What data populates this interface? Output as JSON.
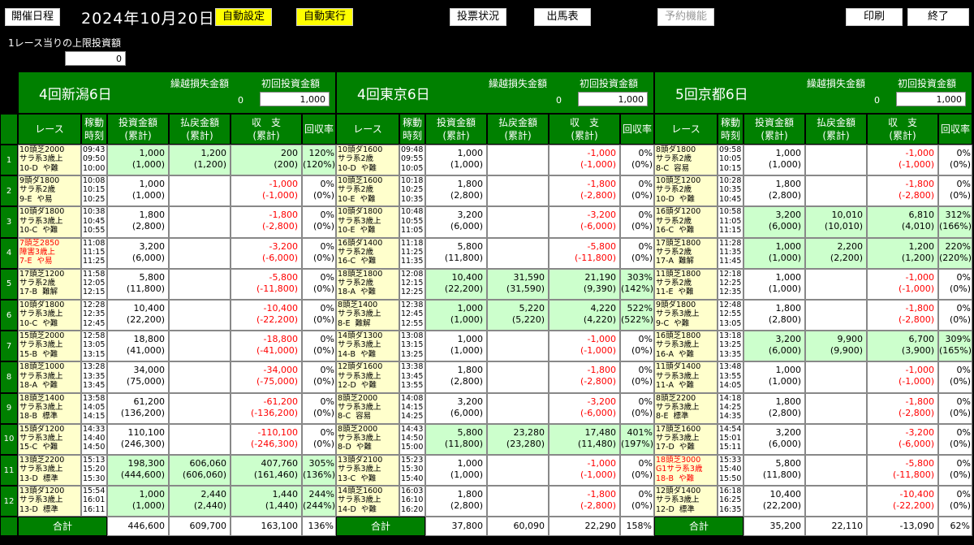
{
  "toolbar": {
    "schedule": "開催日程",
    "date": "2024年10月20日",
    "auto_set": "自動設定",
    "auto_run": "自動実行",
    "vote_status": "投票状況",
    "entries": "出馬表",
    "reserve": "予約機能",
    "print": "印刷",
    "exit": "終了"
  },
  "limit": {
    "label": "1レース当りの上限投資額",
    "value": "0"
  },
  "labels": {
    "carryover": "繰越損失金額",
    "initial": "初回投資金額",
    "race": "レース",
    "op1": "稼動",
    "op2": "時刻",
    "inv1": "投資金額",
    "inv2": "(累計)",
    "pay1": "払戻金額",
    "pay2": "(累計)",
    "bal1": "収　支",
    "bal2": "(累計)",
    "ret": "回収率",
    "total": "合計"
  },
  "venues": [
    {
      "name": "4回新潟6日",
      "carryover": "0",
      "initial": "1,000",
      "total": {
        "invest": "446,600",
        "payout": "609,700",
        "balance": "163,100",
        "rate": "136%"
      },
      "rows": [
        {
          "race": "10頭芝2000\nサラ系3歳上\n10-D  や難",
          "time": "09:43\n09:50\n10:00",
          "inv": "1,000",
          "invc": "(1,000)",
          "pay": "1,200",
          "payc": "(1,200)",
          "bal": "200",
          "balc": "(200)",
          "rate": "120%",
          "ratec": "(120%)",
          "win": true,
          "neg": false,
          "red": false
        },
        {
          "race": "9頭ダ1800\nサラ系2歳\n9-E  や易",
          "time": "10:08\n10:15\n10:25",
          "inv": "1,000",
          "invc": "(1,000)",
          "pay": "",
          "payc": "",
          "bal": "-1,000",
          "balc": "(-1,000)",
          "rate": "0%",
          "ratec": "(0%)",
          "win": false,
          "neg": true,
          "red": false
        },
        {
          "race": "10頭ダ1800\nサラ系3歳上\n10-C  や難",
          "time": "10:38\n10:45\n10:55",
          "inv": "1,800",
          "invc": "(2,800)",
          "pay": "",
          "payc": "",
          "bal": "-1,800",
          "balc": "(-2,800)",
          "rate": "0%",
          "ratec": "(0%)",
          "win": false,
          "neg": true,
          "red": false
        },
        {
          "race": "7頭芝2850\n障害3歳上\n7-E  や易",
          "time": "11:08\n11:15\n11:25",
          "inv": "3,200",
          "invc": "(6,000)",
          "pay": "",
          "payc": "",
          "bal": "-3,200",
          "balc": "(-6,000)",
          "rate": "0%",
          "ratec": "(0%)",
          "win": false,
          "neg": true,
          "red": true
        },
        {
          "race": "17頭芝1200\nサラ系2歳\n17-B  難解",
          "time": "11:58\n12:05\n12:15",
          "inv": "5,800",
          "invc": "(11,800)",
          "pay": "",
          "payc": "",
          "bal": "-5,800",
          "balc": "(-11,800)",
          "rate": "0%",
          "ratec": "(0%)",
          "win": false,
          "neg": true,
          "red": false
        },
        {
          "race": "10頭ダ1800\nサラ系3歳上\n10-C  や難",
          "time": "12:28\n12:35\n12:45",
          "inv": "10,400",
          "invc": "(22,200)",
          "pay": "",
          "payc": "",
          "bal": "-10,400",
          "balc": "(-22,200)",
          "rate": "0%",
          "ratec": "(0%)",
          "win": false,
          "neg": true,
          "red": false
        },
        {
          "race": "15頭芝2000\nサラ系3歳上\n15-B  や難",
          "time": "12:58\n13:05\n13:15",
          "inv": "18,800",
          "invc": "(41,000)",
          "pay": "",
          "payc": "",
          "bal": "-18,800",
          "balc": "(-41,000)",
          "rate": "0%",
          "ratec": "(0%)",
          "win": false,
          "neg": true,
          "red": false
        },
        {
          "race": "18頭芝1000\nサラ系3歳上\n18-A  や難",
          "time": "13:28\n13:35\n13:45",
          "inv": "34,000",
          "invc": "(75,000)",
          "pay": "",
          "payc": "",
          "bal": "-34,000",
          "balc": "(-75,000)",
          "rate": "0%",
          "ratec": "(0%)",
          "win": false,
          "neg": true,
          "red": false
        },
        {
          "race": "18頭芝1400\nサラ系3歳上\n18-B  標準",
          "time": "13:58\n14:05\n14:15",
          "inv": "61,200",
          "invc": "(136,200)",
          "pay": "",
          "payc": "",
          "bal": "-61,200",
          "balc": "(-136,200)",
          "rate": "0%",
          "ratec": "(0%)",
          "win": false,
          "neg": true,
          "red": false
        },
        {
          "race": "15頭ダ1200\nサラ系3歳上\n15-C  や難",
          "time": "14:33\n14:40\n14:50",
          "inv": "110,100",
          "invc": "(246,300)",
          "pay": "",
          "payc": "",
          "bal": "-110,100",
          "balc": "(-246,300)",
          "rate": "0%",
          "ratec": "(0%)",
          "win": false,
          "neg": true,
          "red": false
        },
        {
          "race": "13頭芝2200\nサラ系3歳上\n13-D  標準",
          "time": "15:13\n15:20\n15:30",
          "inv": "198,300",
          "invc": "(444,600)",
          "pay": "606,060",
          "payc": "(606,060)",
          "bal": "407,760",
          "balc": "(161,460)",
          "rate": "305%",
          "ratec": "(136%)",
          "win": true,
          "neg": false,
          "red": false
        },
        {
          "race": "13頭ダ1200\nサラ系3歳上\n13-D  標準",
          "time": "15:54\n16:01\n16:11",
          "inv": "1,000",
          "invc": "(1,000)",
          "pay": "2,440",
          "payc": "(2,440)",
          "bal": "1,440",
          "balc": "(1,440)",
          "rate": "244%",
          "ratec": "(244%)",
          "win": true,
          "neg": false,
          "red": false
        }
      ]
    },
    {
      "name": "4回東京6日",
      "carryover": "0",
      "initial": "1,000",
      "total": {
        "invest": "37,800",
        "payout": "60,090",
        "balance": "22,290",
        "rate": "158%"
      },
      "rows": [
        {
          "race": "10頭ダ1600\nサラ系2歳\n10-D  や難",
          "time": "09:48\n09:55\n10:05",
          "inv": "1,000",
          "invc": "(1,000)",
          "pay": "",
          "payc": "",
          "bal": "-1,000",
          "balc": "(-1,000)",
          "rate": "0%",
          "ratec": "(0%)",
          "win": false,
          "neg": true,
          "red": false
        },
        {
          "race": "10頭芝1600\nサラ系2歳\n10-E  や難",
          "time": "10:18\n10:25\n10:35",
          "inv": "1,800",
          "invc": "(2,800)",
          "pay": "",
          "payc": "",
          "bal": "-1,800",
          "balc": "(-2,800)",
          "rate": "0%",
          "ratec": "(0%)",
          "win": false,
          "neg": true,
          "red": false
        },
        {
          "race": "10頭ダ1800\nサラ系3歳上\n10-E  や難",
          "time": "10:48\n10:55\n11:05",
          "inv": "3,200",
          "invc": "(6,000)",
          "pay": "",
          "payc": "",
          "bal": "-3,200",
          "balc": "(-6,000)",
          "rate": "0%",
          "ratec": "(0%)",
          "win": false,
          "neg": true,
          "red": false
        },
        {
          "race": "16頭ダ1400\nサラ系2歳\n16-C  や難",
          "time": "11:18\n11:25\n11:35",
          "inv": "5,800",
          "invc": "(11,800)",
          "pay": "",
          "payc": "",
          "bal": "-5,800",
          "balc": "(-11,800)",
          "rate": "0%",
          "ratec": "(0%)",
          "win": false,
          "neg": true,
          "red": false
        },
        {
          "race": "18頭芝1800\nサラ系2歳\n18-A  や難",
          "time": "12:08\n12:15\n12:25",
          "inv": "10,400",
          "invc": "(22,200)",
          "pay": "31,590",
          "payc": "(31,590)",
          "bal": "21,190",
          "balc": "(9,390)",
          "rate": "303%",
          "ratec": "(142%)",
          "win": true,
          "neg": false,
          "red": false
        },
        {
          "race": "8頭芝1400\nサラ系3歳上\n8-E  難解",
          "time": "12:38\n12:45\n12:55",
          "inv": "1,000",
          "invc": "(1,000)",
          "pay": "5,220",
          "payc": "(5,220)",
          "bal": "4,220",
          "balc": "(4,220)",
          "rate": "522%",
          "ratec": "(522%)",
          "win": true,
          "neg": false,
          "red": false
        },
        {
          "race": "14頭ダ1300\nサラ系3歳上\n14-B  や難",
          "time": "13:08\n13:15\n13:25",
          "inv": "1,000",
          "invc": "(1,000)",
          "pay": "",
          "payc": "",
          "bal": "-1,000",
          "balc": "(-1,000)",
          "rate": "0%",
          "ratec": "(0%)",
          "win": false,
          "neg": true,
          "red": false
        },
        {
          "race": "12頭ダ1600\nサラ系3歳上\n12-D  や難",
          "time": "13:38\n13:45\n13:55",
          "inv": "1,800",
          "invc": "(2,800)",
          "pay": "",
          "payc": "",
          "bal": "-1,800",
          "balc": "(-2,800)",
          "rate": "0%",
          "ratec": "(0%)",
          "win": false,
          "neg": true,
          "red": false
        },
        {
          "race": "8頭芝2000\nサラ系3歳上\n8-C  容易",
          "time": "14:08\n14:15\n14:25",
          "inv": "3,200",
          "invc": "(6,000)",
          "pay": "",
          "payc": "",
          "bal": "-3,200",
          "balc": "(-6,000)",
          "rate": "0%",
          "ratec": "(0%)",
          "win": false,
          "neg": true,
          "red": false
        },
        {
          "race": "8頭芝2000\nサラ系3歳上\n8-D  や難",
          "time": "14:43\n14:50\n15:00",
          "inv": "5,800",
          "invc": "(11,800)",
          "pay": "23,280",
          "payc": "(23,280)",
          "bal": "17,480",
          "balc": "(11,480)",
          "rate": "401%",
          "ratec": "(197%)",
          "win": true,
          "neg": false,
          "red": false
        },
        {
          "race": "13頭ダ2100\nサラ系3歳上\n13-C  や難",
          "time": "15:23\n15:30\n15:40",
          "inv": "1,000",
          "invc": "(1,000)",
          "pay": "",
          "payc": "",
          "bal": "-1,000",
          "balc": "(-1,000)",
          "rate": "0%",
          "ratec": "(0%)",
          "win": false,
          "neg": true,
          "red": false
        },
        {
          "race": "14頭芝1600\nサラ系3歳上\n14-D  や難",
          "time": "16:03\n16:10\n16:20",
          "inv": "1,800",
          "invc": "(2,800)",
          "pay": "",
          "payc": "",
          "bal": "-1,800",
          "balc": "(-2,800)",
          "rate": "0%",
          "ratec": "(0%)",
          "win": false,
          "neg": true,
          "red": false
        }
      ]
    },
    {
      "name": "5回京都6日",
      "carryover": "0",
      "initial": "1,000",
      "total": {
        "invest": "35,200",
        "payout": "22,110",
        "balance": "-13,090",
        "rate": "62%"
      },
      "rows": [
        {
          "race": "8頭ダ1800\nサラ系2歳\n8-C  容易",
          "time": "09:58\n10:05\n10:15",
          "inv": "1,000",
          "invc": "(1,000)",
          "pay": "",
          "payc": "",
          "bal": "-1,000",
          "balc": "(-1,000)",
          "rate": "0%",
          "ratec": "(0%)",
          "win": false,
          "neg": true,
          "red": false
        },
        {
          "race": "10頭芝1200\nサラ系2歳\n10-D  や難",
          "time": "10:28\n10:35\n10:45",
          "inv": "1,800",
          "invc": "(2,800)",
          "pay": "",
          "payc": "",
          "bal": "-1,800",
          "balc": "(-2,800)",
          "rate": "0%",
          "ratec": "(0%)",
          "win": false,
          "neg": true,
          "red": false
        },
        {
          "race": "16頭ダ1200\nサラ系2歳\n16-C  や難",
          "time": "10:58\n11:05\n11:15",
          "inv": "3,200",
          "invc": "(6,000)",
          "pay": "10,010",
          "payc": "(10,010)",
          "bal": "6,810",
          "balc": "(4,010)",
          "rate": "312%",
          "ratec": "(166%)",
          "win": true,
          "neg": false,
          "red": false
        },
        {
          "race": "17頭芝1800\nサラ系2歳\n17-A  難解",
          "time": "11:28\n11:35\n11:45",
          "inv": "1,000",
          "invc": "(1,000)",
          "pay": "2,200",
          "payc": "(2,200)",
          "bal": "1,200",
          "balc": "(1,200)",
          "rate": "220%",
          "ratec": "(220%)",
          "win": true,
          "neg": false,
          "red": false
        },
        {
          "race": "11頭芝1800\nサラ系2歳\n11-E  や難",
          "time": "12:18\n12:25\n12:35",
          "inv": "1,000",
          "invc": "(1,000)",
          "pay": "",
          "payc": "",
          "bal": "-1,000",
          "balc": "(-1,000)",
          "rate": "0%",
          "ratec": "(0%)",
          "win": false,
          "neg": true,
          "red": false
        },
        {
          "race": "9頭ダ1800\nサラ系3歳上\n9-C  や難",
          "time": "12:48\n12:55\n13:05",
          "inv": "1,800",
          "invc": "(2,800)",
          "pay": "",
          "payc": "",
          "bal": "-1,800",
          "balc": "(-2,800)",
          "rate": "0%",
          "ratec": "(0%)",
          "win": false,
          "neg": true,
          "red": false
        },
        {
          "race": "16頭芝1800\nサラ系3歳上\n16-A  や難",
          "time": "13:18\n13:25\n13:35",
          "inv": "3,200",
          "invc": "(6,000)",
          "pay": "9,900",
          "payc": "(9,900)",
          "bal": "6,700",
          "balc": "(3,900)",
          "rate": "309%",
          "ratec": "(165%)",
          "win": true,
          "neg": false,
          "red": false
        },
        {
          "race": "11頭ダ1400\nサラ系3歳上\n11-A  や難",
          "time": "13:48\n13:55\n14:05",
          "inv": "1,000",
          "invc": "(1,000)",
          "pay": "",
          "payc": "",
          "bal": "-1,000",
          "balc": "(-1,000)",
          "rate": "0%",
          "ratec": "(0%)",
          "win": false,
          "neg": true,
          "red": false
        },
        {
          "race": "8頭芝2200\nサラ系3歳上\n8-E  標準",
          "time": "14:18\n14:25\n14:35",
          "inv": "1,800",
          "invc": "(2,800)",
          "pay": "",
          "payc": "",
          "bal": "-1,800",
          "balc": "(-2,800)",
          "rate": "0%",
          "ratec": "(0%)",
          "win": false,
          "neg": true,
          "red": false
        },
        {
          "race": "17頭芝1600\nサラ系3歳上\n17-D  や難",
          "time": "14:54\n15:01\n15:11",
          "inv": "3,200",
          "invc": "(6,000)",
          "pay": "",
          "payc": "",
          "bal": "-3,200",
          "balc": "(-6,000)",
          "rate": "0%",
          "ratec": "(0%)",
          "win": false,
          "neg": true,
          "red": false
        },
        {
          "race": "18頭芝3000\nG1サラ系3歳\n18-B  や難",
          "time": "15:33\n15:40\n15:50",
          "inv": "5,800",
          "invc": "(11,800)",
          "pay": "",
          "payc": "",
          "bal": "-5,800",
          "balc": "(-11,800)",
          "rate": "0%",
          "ratec": "(0%)",
          "win": false,
          "neg": true,
          "red": true
        },
        {
          "race": "12頭ダ1400\nサラ系3歳上\n12-D  標準",
          "time": "16:18\n16:25\n16:35",
          "inv": "10,400",
          "invc": "(22,200)",
          "pay": "",
          "payc": "",
          "bal": "-10,400",
          "balc": "(-22,200)",
          "rate": "0%",
          "ratec": "(0%)",
          "win": false,
          "neg": true,
          "red": false
        }
      ]
    }
  ],
  "colors": {
    "header_green": "#008000",
    "win_green": "#ccffcc",
    "race_yellow": "#ffffcc",
    "negative": "#ff0000",
    "button_yellow": "#ffff00"
  }
}
